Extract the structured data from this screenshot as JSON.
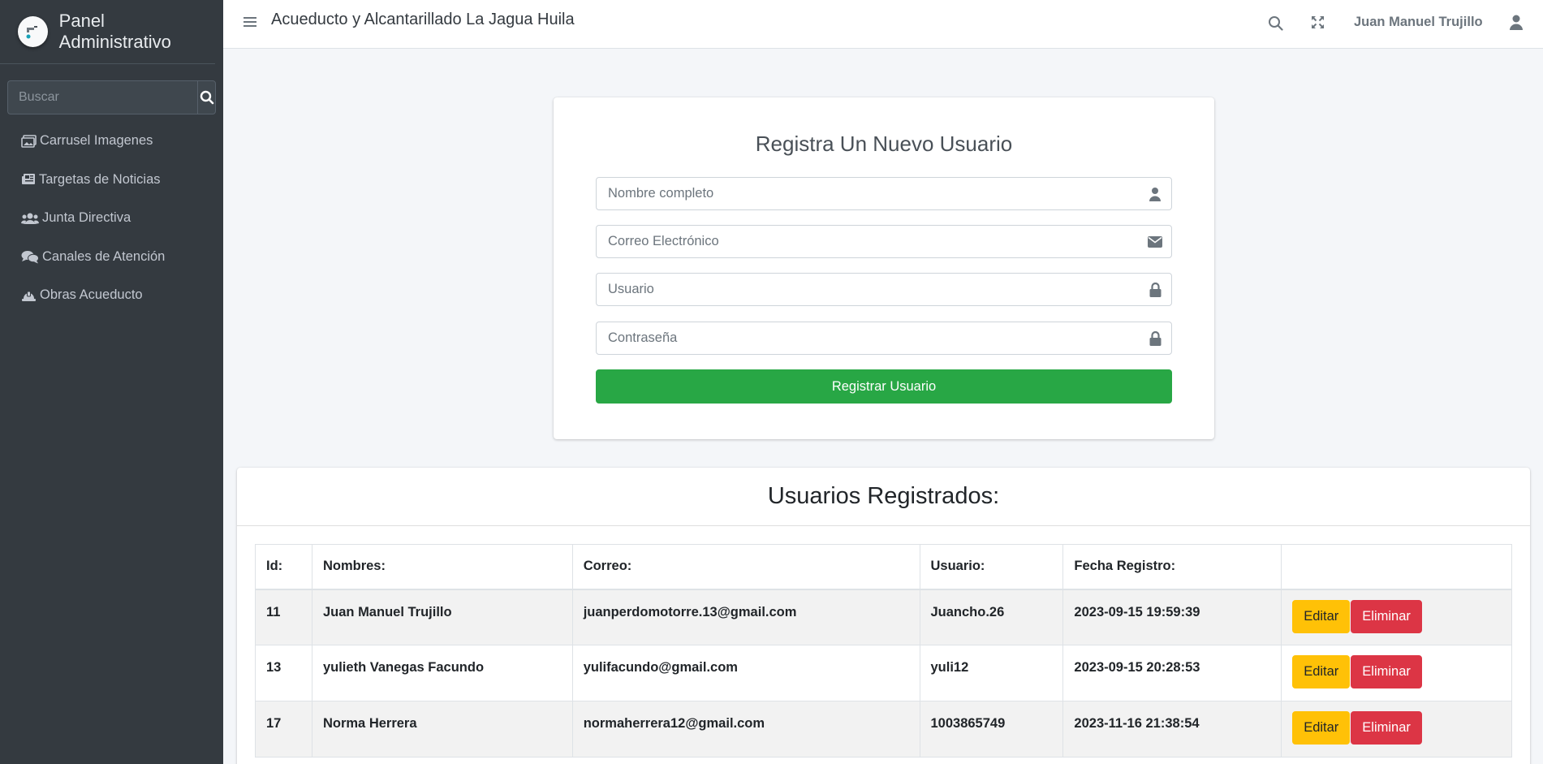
{
  "sidebar": {
    "brand": "Panel Administrativo",
    "search_placeholder": "Buscar",
    "items": [
      {
        "label": "Carrusel Imagenes",
        "icon": "images-icon"
      },
      {
        "label": "Targetas de Noticias",
        "icon": "newspaper-icon"
      },
      {
        "label": "Junta Directiva",
        "icon": "users-icon"
      },
      {
        "label": "Canales de Atención",
        "icon": "comments-icon"
      },
      {
        "label": "Obras Acueducto",
        "icon": "hard-hat-icon"
      }
    ]
  },
  "header": {
    "title": "Acueducto y Alcantarillado La Jagua Huila",
    "user_name": "Juan Manuel Trujillo"
  },
  "register": {
    "title": "Registra Un Nuevo Usuario",
    "fields": {
      "name_placeholder": "Nombre completo",
      "email_placeholder": "Correo Electrónico",
      "user_placeholder": "Usuario",
      "password_placeholder": "Contraseña"
    },
    "submit_label": "Registrar Usuario"
  },
  "users": {
    "title": "Usuarios Registrados:",
    "columns": [
      "Id:",
      "Nombres:",
      "Correo:",
      "Usuario:",
      "Fecha Registro:",
      ""
    ],
    "rows": [
      {
        "id": "11",
        "name": "Juan Manuel Trujillo",
        "email": "juanperdomotorre.13@gmail.com",
        "user": "Juancho.26",
        "date": "2023-09-15 19:59:39"
      },
      {
        "id": "13",
        "name": "yulieth Vanegas Facundo",
        "email": "yulifacundo@gmail.com",
        "user": "yuli12",
        "date": "2023-09-15 20:28:53"
      },
      {
        "id": "17",
        "name": "Norma Herrera",
        "email": "normaherrera12@gmail.com",
        "user": "1003865749",
        "date": "2023-11-16 21:38:54"
      }
    ],
    "edit_label": "Editar",
    "delete_label": "Eliminar"
  },
  "colors": {
    "sidebar_bg": "#343a40",
    "success": "#28a745",
    "warning": "#ffc107",
    "danger": "#dc3545"
  }
}
